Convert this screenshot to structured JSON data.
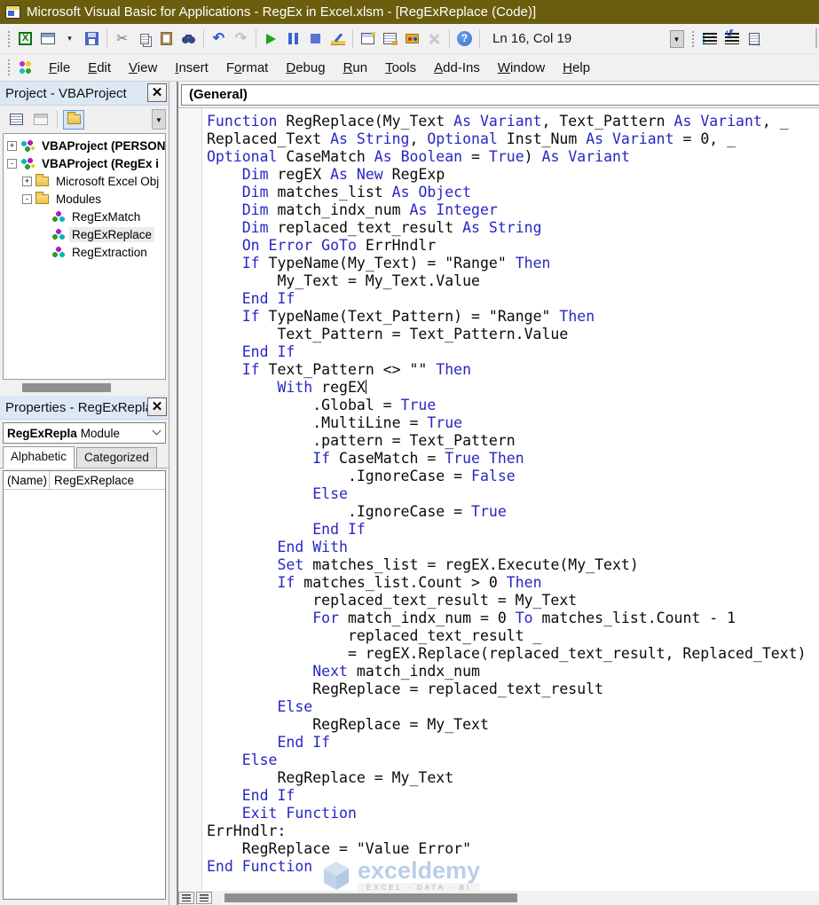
{
  "colors": {
    "titlebar_bg": "#6b5d0e",
    "keyword_blue": "#2727c4",
    "code_text": "#0a0a0a",
    "selection_bg": "#ececec",
    "panel_header_bg": "#dde8f5",
    "toolbar_bg": "#f1f1f1",
    "run_green": "#1fa11f",
    "help_blue": "#3a76d6",
    "watermark_blue": "#aec6e8"
  },
  "title_bar": {
    "title": "Microsoft Visual Basic for Applications - RegEx in Excel.xlsm - [RegExReplace (Code)]"
  },
  "toolbar": {
    "position": "Ln 16, Col 19",
    "items": [
      {
        "t": "grip"
      },
      {
        "t": "icon",
        "name": "excel-icon",
        "glyph": "X"
      },
      {
        "t": "icon",
        "name": "view-object-icon"
      },
      {
        "t": "icon",
        "name": "dropdown-caret-icon",
        "glyph": "▾"
      },
      {
        "t": "icon",
        "name": "save-icon"
      },
      {
        "t": "sep"
      },
      {
        "t": "icon",
        "name": "cut-icon",
        "glyph": "✂"
      },
      {
        "t": "icon",
        "name": "copy-icon"
      },
      {
        "t": "icon",
        "name": "paste-icon"
      },
      {
        "t": "icon",
        "name": "find-icon"
      },
      {
        "t": "sep"
      },
      {
        "t": "icon",
        "name": "undo-icon",
        "glyph": "↶"
      },
      {
        "t": "icon",
        "name": "redo-icon",
        "glyph": "↷",
        "disabled": true
      },
      {
        "t": "sep"
      },
      {
        "t": "icon",
        "name": "run-icon"
      },
      {
        "t": "icon",
        "name": "break-icon"
      },
      {
        "t": "icon",
        "name": "reset-icon"
      },
      {
        "t": "icon",
        "name": "design-mode-icon"
      },
      {
        "t": "sep"
      },
      {
        "t": "icon",
        "name": "project-explorer-icon"
      },
      {
        "t": "icon",
        "name": "properties-window-icon"
      },
      {
        "t": "icon",
        "name": "toolbox-icon"
      },
      {
        "t": "icon",
        "name": "object-browser-icon",
        "disabled": true
      },
      {
        "t": "sep"
      },
      {
        "t": "icon",
        "name": "help-icon",
        "glyph": "?"
      },
      {
        "t": "sep"
      },
      {
        "t": "text",
        "key": "position"
      },
      {
        "t": "icon",
        "name": "toolbar-overflow-icon",
        "glyph": "▼"
      },
      {
        "t": "grip"
      },
      {
        "t": "icon",
        "name": "indent-icon"
      },
      {
        "t": "icon",
        "name": "comment-block-icon"
      },
      {
        "t": "icon",
        "name": "copy-arrow-icon"
      }
    ]
  },
  "menu": {
    "items": [
      {
        "label": "File",
        "u": 0
      },
      {
        "label": "Edit",
        "u": 0
      },
      {
        "label": "View",
        "u": 0
      },
      {
        "label": "Insert",
        "u": 0
      },
      {
        "label": "Format",
        "u": 1
      },
      {
        "label": "Debug",
        "u": 0
      },
      {
        "label": "Run",
        "u": 0
      },
      {
        "label": "Tools",
        "u": 0
      },
      {
        "label": "Add-Ins",
        "u": 0
      },
      {
        "label": "Window",
        "u": 0
      },
      {
        "label": "Help",
        "u": 0
      }
    ]
  },
  "project_panel": {
    "title": "Project - VBAProject",
    "tree": [
      {
        "expand": "+",
        "icon": "vbaproject",
        "label": "VBAProject (PERSON",
        "bold": true,
        "indent": 0,
        "selected": false
      },
      {
        "expand": "-",
        "icon": "vbaproject",
        "label": "VBAProject (RegEx i",
        "bold": true,
        "indent": 0,
        "selected": false
      },
      {
        "expand": "+",
        "icon": "folder",
        "label": "Microsoft Excel Obj",
        "bold": false,
        "indent": 1,
        "selected": false
      },
      {
        "expand": "-",
        "icon": "folder",
        "label": "Modules",
        "bold": false,
        "indent": 1,
        "selected": false
      },
      {
        "expand": "",
        "icon": "module",
        "label": "RegExMatch",
        "bold": false,
        "indent": 2,
        "selected": false
      },
      {
        "expand": "",
        "icon": "module",
        "label": "RegExReplace",
        "bold": false,
        "indent": 2,
        "selected": true
      },
      {
        "expand": "",
        "icon": "module",
        "label": "RegExtraction",
        "bold": false,
        "indent": 2,
        "selected": false
      }
    ]
  },
  "properties_panel": {
    "title": "Properties - RegExRepla",
    "object_name": "RegExRepla",
    "object_type": "Module",
    "tabs": [
      "Alphabetic",
      "Categorized"
    ],
    "active_tab": 0,
    "rows": [
      {
        "key": "(Name)",
        "value": "RegExReplace"
      }
    ]
  },
  "code_window": {
    "object_dropdown": "(General)",
    "caret_line": 15,
    "lines": [
      [
        [
          "k",
          "Function "
        ],
        [
          "n",
          "RegReplace(My_Text "
        ],
        [
          "k",
          "As Variant"
        ],
        [
          "n",
          ", Text_Pattern "
        ],
        [
          "k",
          "As Variant"
        ],
        [
          "n",
          ", _"
        ]
      ],
      [
        [
          "n",
          "Replaced_Text "
        ],
        [
          "k",
          "As String"
        ],
        [
          "n",
          ", "
        ],
        [
          "k",
          "Optional"
        ],
        [
          "n",
          " Inst_Num "
        ],
        [
          "k",
          "As Variant"
        ],
        [
          "n",
          " = 0, _"
        ]
      ],
      [
        [
          "k",
          "Optional"
        ],
        [
          "n",
          " CaseMatch "
        ],
        [
          "k",
          "As Boolean"
        ],
        [
          "n",
          " = "
        ],
        [
          "k",
          "True"
        ],
        [
          "n",
          ") "
        ],
        [
          "k",
          "As Variant"
        ]
      ],
      [
        [
          "n",
          "    "
        ],
        [
          "k",
          "Dim"
        ],
        [
          "n",
          " regEX "
        ],
        [
          "k",
          "As New"
        ],
        [
          "n",
          " RegExp"
        ]
      ],
      [
        [
          "n",
          "    "
        ],
        [
          "k",
          "Dim"
        ],
        [
          "n",
          " matches_list "
        ],
        [
          "k",
          "As Object"
        ]
      ],
      [
        [
          "n",
          "    "
        ],
        [
          "k",
          "Dim"
        ],
        [
          "n",
          " match_indx_num "
        ],
        [
          "k",
          "As Integer"
        ]
      ],
      [
        [
          "n",
          "    "
        ],
        [
          "k",
          "Dim"
        ],
        [
          "n",
          " replaced_text_result "
        ],
        [
          "k",
          "As String"
        ]
      ],
      [
        [
          "n",
          "    "
        ],
        [
          "k",
          "On Error GoTo"
        ],
        [
          "n",
          " ErrHndlr"
        ]
      ],
      [
        [
          "n",
          "    "
        ],
        [
          "k",
          "If"
        ],
        [
          "n",
          " TypeName(My_Text) = \"Range\" "
        ],
        [
          "k",
          "Then"
        ]
      ],
      [
        [
          "n",
          "        My_Text = My_Text.Value"
        ]
      ],
      [
        [
          "n",
          "    "
        ],
        [
          "k",
          "End If"
        ]
      ],
      [
        [
          "n",
          "    "
        ],
        [
          "k",
          "If"
        ],
        [
          "n",
          " TypeName(Text_Pattern) = \"Range\" "
        ],
        [
          "k",
          "Then"
        ]
      ],
      [
        [
          "n",
          "        Text_Pattern = Text_Pattern.Value"
        ]
      ],
      [
        [
          "n",
          "    "
        ],
        [
          "k",
          "End If"
        ]
      ],
      [
        [
          "n",
          "    "
        ],
        [
          "k",
          "If"
        ],
        [
          "n",
          " Text_Pattern <> \"\" "
        ],
        [
          "k",
          "Then"
        ]
      ],
      [
        [
          "n",
          "        "
        ],
        [
          "k",
          "With"
        ],
        [
          "n",
          " regEX"
        ]
      ],
      [
        [
          "n",
          "            .Global = "
        ],
        [
          "k",
          "True"
        ]
      ],
      [
        [
          "n",
          "            .MultiLine = "
        ],
        [
          "k",
          "True"
        ]
      ],
      [
        [
          "n",
          "            .pattern = Text_Pattern"
        ]
      ],
      [
        [
          "n",
          "            "
        ],
        [
          "k",
          "If"
        ],
        [
          "n",
          " CaseMatch = "
        ],
        [
          "k",
          "True"
        ],
        [
          "n",
          " "
        ],
        [
          "k",
          "Then"
        ]
      ],
      [
        [
          "n",
          "                .IgnoreCase = "
        ],
        [
          "k",
          "False"
        ]
      ],
      [
        [
          "n",
          "            "
        ],
        [
          "k",
          "Else"
        ]
      ],
      [
        [
          "n",
          "                .IgnoreCase = "
        ],
        [
          "k",
          "True"
        ]
      ],
      [
        [
          "n",
          "            "
        ],
        [
          "k",
          "End If"
        ]
      ],
      [
        [
          "n",
          "        "
        ],
        [
          "k",
          "End With"
        ]
      ],
      [
        [
          "n",
          "        "
        ],
        [
          "k",
          "Set"
        ],
        [
          "n",
          " matches_list = regEX.Execute(My_Text)"
        ]
      ],
      [
        [
          "n",
          "        "
        ],
        [
          "k",
          "If"
        ],
        [
          "n",
          " matches_list.Count > 0 "
        ],
        [
          "k",
          "Then"
        ]
      ],
      [
        [
          "n",
          "            replaced_text_result = My_Text"
        ]
      ],
      [
        [
          "n",
          "            "
        ],
        [
          "k",
          "For"
        ],
        [
          "n",
          " match_indx_num = 0 "
        ],
        [
          "k",
          "To"
        ],
        [
          "n",
          " matches_list.Count - 1"
        ]
      ],
      [
        [
          "n",
          "                replaced_text_result _"
        ]
      ],
      [
        [
          "n",
          "                = regEX.Replace(replaced_text_result, Replaced_Text)"
        ]
      ],
      [
        [
          "n",
          "            "
        ],
        [
          "k",
          "Next"
        ],
        [
          "n",
          " match_indx_num"
        ]
      ],
      [
        [
          "n",
          "            RegReplace = replaced_text_result"
        ]
      ],
      [
        [
          "n",
          "        "
        ],
        [
          "k",
          "Else"
        ]
      ],
      [
        [
          "n",
          "            RegReplace = My_Text"
        ]
      ],
      [
        [
          "n",
          "        "
        ],
        [
          "k",
          "End If"
        ]
      ],
      [
        [
          "n",
          "    "
        ],
        [
          "k",
          "Else"
        ]
      ],
      [
        [
          "n",
          "        RegReplace = My_Text"
        ]
      ],
      [
        [
          "n",
          "    "
        ],
        [
          "k",
          "End If"
        ]
      ],
      [
        [
          "n",
          "    "
        ],
        [
          "k",
          "Exit Function"
        ]
      ],
      [
        [
          "n",
          "ErrHndlr:"
        ]
      ],
      [
        [
          "n",
          "    RegReplace = \"Value Error\""
        ]
      ],
      [
        [
          "k",
          "End Function"
        ]
      ]
    ]
  },
  "watermark": {
    "name": "exceldemy",
    "tagline": "EXCEL - DATA - BI"
  }
}
